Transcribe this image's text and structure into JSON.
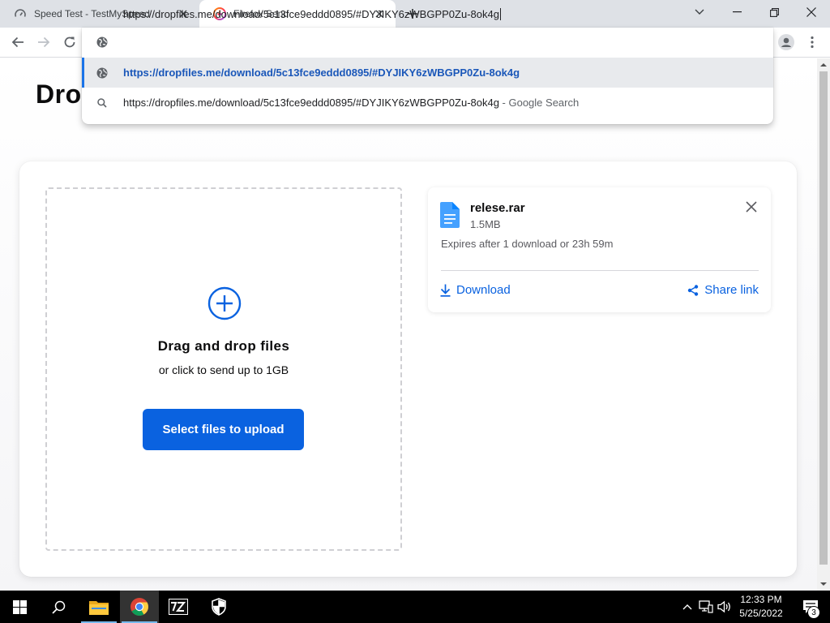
{
  "browser": {
    "tabs": [
      {
        "title": "Speed Test - TestMySpeed",
        "favicon": "speedometer-icon",
        "active": false
      },
      {
        "title": "Firefox Send",
        "favicon": "firefox-send-icon",
        "active": true
      }
    ],
    "omnibox": {
      "value": "https://dropfiles.me/download/5c13fce9eddd0895/#DYJIKY6zWBGPP0Zu-8ok4g"
    },
    "suggestions": [
      {
        "icon": "globe-icon",
        "text": "https://dropfiles.me/download/5c13fce9eddd0895/#DYJIKY6zWBGPP0Zu-8ok4g",
        "suffix": ""
      },
      {
        "icon": "search-icon",
        "text": "https://dropfiles.me/download/5c13fce9eddd0895/#DYJIKY6zWBGPP0Zu-8ok4g",
        "suffix": " - Google Search"
      }
    ]
  },
  "page": {
    "title": "Drop",
    "dropzone": {
      "title": "Drag and drop files",
      "subtitle": "or click to send up to 1GB",
      "button_label": "Select files to upload"
    },
    "file": {
      "name": "relese.rar",
      "size": "1.5MB",
      "expiry": "Expires after 1 download or 23h 59m",
      "download_label": "Download",
      "share_label": "Share link"
    }
  },
  "taskbar": {
    "time": "12:33 PM",
    "date": "5/25/2022",
    "notification_count": "3",
    "apps": [
      "windows-start-icon",
      "search-icon",
      "file-explorer-icon",
      "chrome-icon",
      "7zip-icon",
      "security-shield-icon"
    ]
  },
  "colors": {
    "accent_blue": "#0a62e0",
    "omnibox_selected": "#1a57b9",
    "tabstrip": "#dee1e6"
  }
}
